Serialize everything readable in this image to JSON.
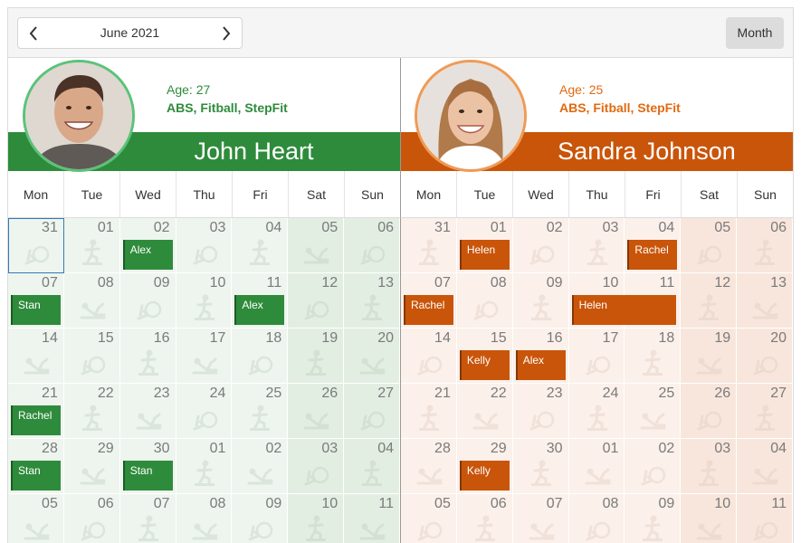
{
  "toolbar": {
    "date_label": "June 2021",
    "view_label": "Month"
  },
  "weekdays": [
    "Mon",
    "Tue",
    "Wed",
    "Thu",
    "Fri",
    "Sat",
    "Sun"
  ],
  "weeks": [
    [
      "31",
      "01",
      "02",
      "03",
      "04",
      "05",
      "06"
    ],
    [
      "07",
      "08",
      "09",
      "10",
      "11",
      "12",
      "13"
    ],
    [
      "14",
      "15",
      "16",
      "17",
      "18",
      "19",
      "20"
    ],
    [
      "21",
      "22",
      "23",
      "24",
      "25",
      "26",
      "27"
    ],
    [
      "28",
      "29",
      "30",
      "01",
      "02",
      "03",
      "04"
    ],
    [
      "05",
      "06",
      "07",
      "08",
      "09",
      "10",
      "11"
    ]
  ],
  "resources": [
    {
      "name": "John Heart",
      "age": "Age: 27",
      "skills": "ABS, Fitball, StepFit",
      "color": "#2e8b3b",
      "text_color": "#2e8b3b",
      "ring_color": "#5cc27a",
      "cell_color": "#eef5ee",
      "weekend_color": "#e3eee3",
      "icon_color": "#b8cab8",
      "num_color": "#7a7a7a",
      "appointments": [
        {
          "label": "Alex",
          "week": 0,
          "day": 2,
          "span": 1
        },
        {
          "label": "Stan",
          "week": 1,
          "day": 0,
          "span": 1
        },
        {
          "label": "Alex",
          "week": 1,
          "day": 4,
          "span": 1
        },
        {
          "label": "Rachel",
          "week": 3,
          "day": 0,
          "span": 1
        },
        {
          "label": "Stan",
          "week": 4,
          "day": 0,
          "span": 1
        },
        {
          "label": "Stan",
          "week": 4,
          "day": 2,
          "span": 1
        }
      ]
    },
    {
      "name": "Sandra Johnson",
      "age": "Age: 25",
      "skills": "ABS, Fitball, StepFit",
      "color": "#c9550a",
      "text_color": "#e06a10",
      "ring_color": "#f09a55",
      "cell_color": "#fbf0ea",
      "weekend_color": "#f8e6dc",
      "icon_color": "#dcc7ba",
      "num_color": "#7a7a7a",
      "appointments": [
        {
          "label": "Helen",
          "week": 0,
          "day": 1,
          "span": 1
        },
        {
          "label": "Rachel",
          "week": 0,
          "day": 4,
          "span": 1
        },
        {
          "label": "Rachel",
          "week": 1,
          "day": 0,
          "span": 1
        },
        {
          "label": "Helen",
          "week": 1,
          "day": 3,
          "span": 2
        },
        {
          "label": "Kelly",
          "week": 2,
          "day": 1,
          "span": 1
        },
        {
          "label": "Alex",
          "week": 2,
          "day": 2,
          "span": 1
        },
        {
          "label": "Kelly",
          "week": 4,
          "day": 1,
          "span": 1
        }
      ]
    }
  ]
}
